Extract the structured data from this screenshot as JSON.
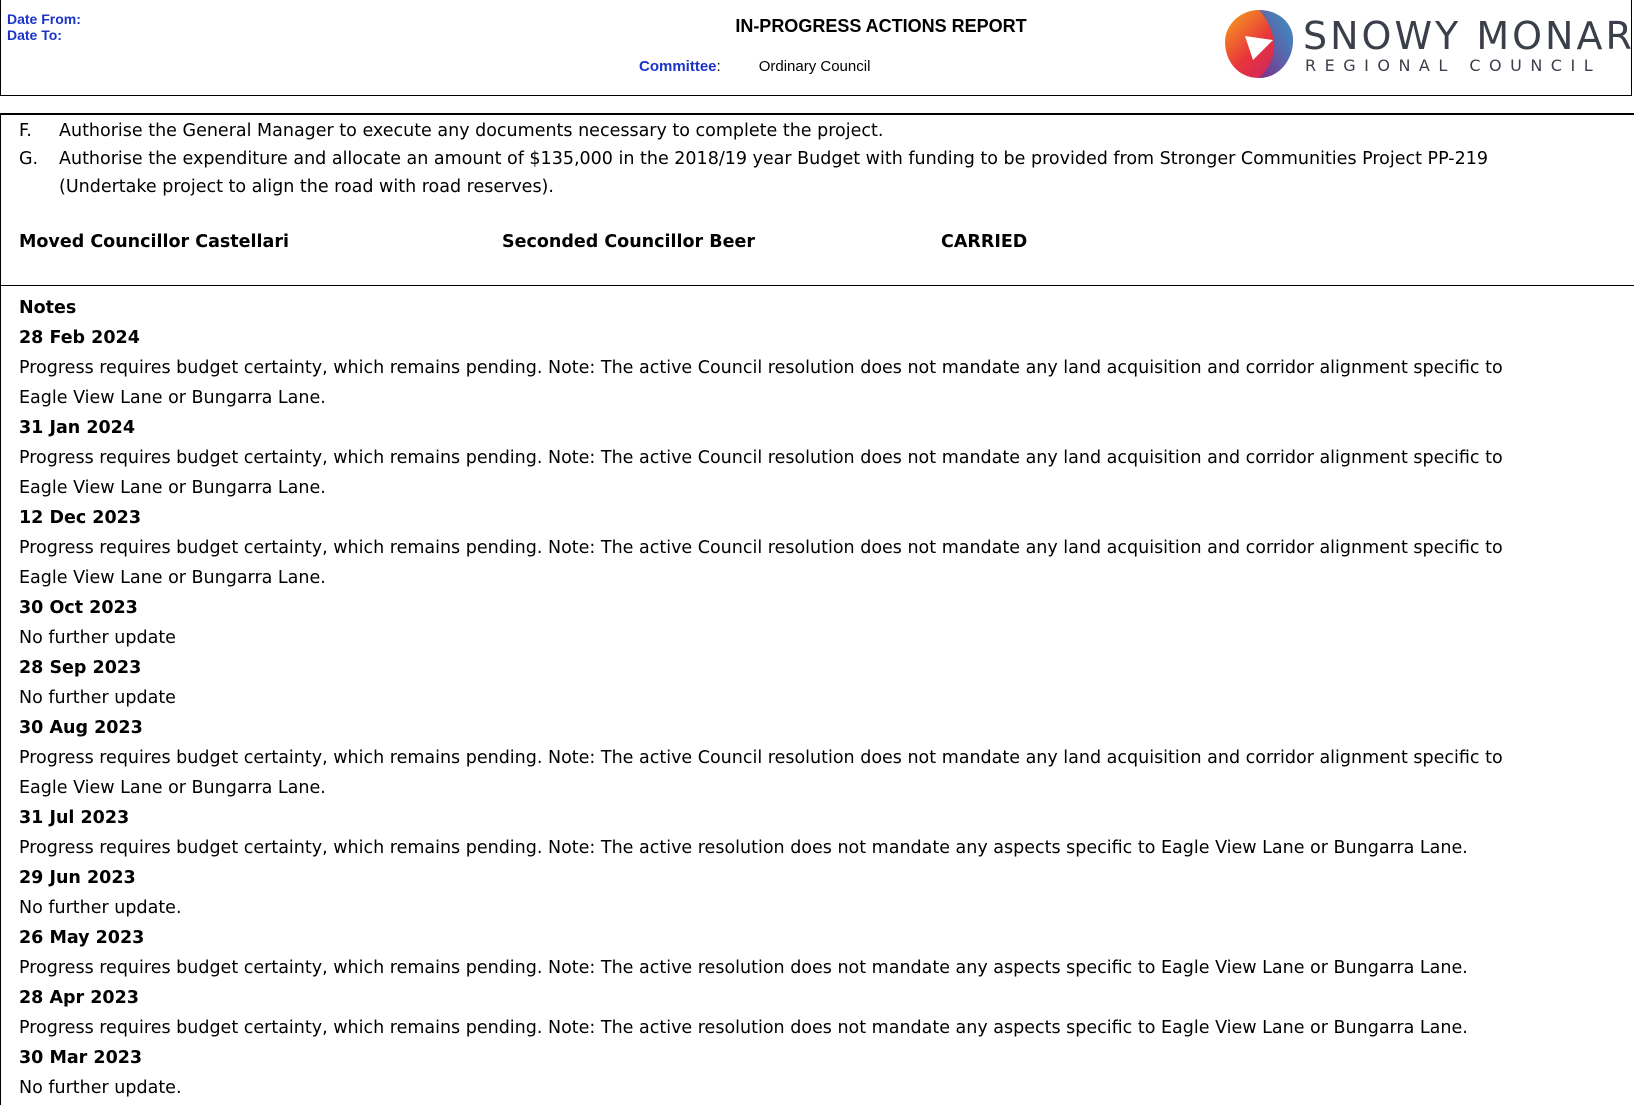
{
  "header": {
    "date_from_label": "Date From:",
    "date_to_label": "Date To:",
    "title": "IN-PROGRESS ACTIONS REPORT",
    "committee_label": "Committee",
    "committee_colon": ":",
    "committee_value": "Ordinary Council"
  },
  "logo": {
    "line1": "SNOWY MONARO",
    "line2": "REGIONAL COUNCIL",
    "colors": [
      "#e8353b",
      "#f7a81b",
      "#1fa6dd",
      "#7b2d8b",
      "#c21f72"
    ]
  },
  "resolution": {
    "items": [
      {
        "letter": "F.",
        "text": "Authorise the General Manager to execute any documents necessary to complete the project.",
        "continuation": ""
      },
      {
        "letter": "G.",
        "text": "Authorise the expenditure and allocate an amount of $135,000 in the 2018/19 year Budget with funding to be provided from Stronger Communities Project PP-219",
        "continuation": "(Undertake project to align the road with road reserves)."
      }
    ],
    "moved": "Moved Councillor Castellari",
    "seconded": "Seconded Councillor Beer",
    "result": "CARRIED"
  },
  "notes": {
    "heading": "Notes",
    "entries": [
      {
        "date": "28 Feb 2024",
        "line1": "Progress requires budget certainty, which remains pending. Note: The active Council resolution does not mandate any land acquisition and corridor alignment specific to",
        "line2": "Eagle View Lane or Bungarra Lane."
      },
      {
        "date": "31 Jan 2024",
        "line1": "Progress requires budget certainty, which remains pending. Note: The active Council resolution does not mandate any land acquisition and corridor alignment specific to",
        "line2": "Eagle View Lane or Bungarra Lane."
      },
      {
        "date": "12 Dec 2023",
        "line1": "Progress requires budget certainty, which remains pending. Note: The active Council resolution does not mandate any land acquisition and corridor alignment specific to",
        "line2": "Eagle View Lane or Bungarra Lane."
      },
      {
        "date": "30 Oct 2023",
        "line1": "No further update",
        "line2": ""
      },
      {
        "date": "28 Sep 2023",
        "line1": "No further update",
        "line2": ""
      },
      {
        "date": "30 Aug 2023",
        "line1": "Progress requires budget certainty, which remains pending. Note: The active Council resolution does not mandate any land acquisition and corridor alignment specific to",
        "line2": "Eagle View Lane or Bungarra Lane."
      },
      {
        "date": "31 Jul 2023",
        "line1": "Progress requires budget certainty, which remains pending. Note: The active resolution does not mandate any aspects specific to Eagle View Lane or Bungarra Lane.",
        "line2": ""
      },
      {
        "date": "29 Jun 2023",
        "line1": "No further update.",
        "line2": ""
      },
      {
        "date": "26 May 2023",
        "line1": "Progress requires budget certainty, which remains pending. Note: The active resolution does not mandate any aspects specific to Eagle View Lane or Bungarra Lane.",
        "line2": ""
      },
      {
        "date": "28 Apr 2023",
        "line1": "Progress requires budget certainty, which remains pending. Note: The active resolution does not mandate any aspects specific to Eagle View Lane or Bungarra Lane.",
        "line2": ""
      },
      {
        "date": "30 Mar 2023",
        "line1": "No further update.",
        "line2": ""
      }
    ]
  }
}
